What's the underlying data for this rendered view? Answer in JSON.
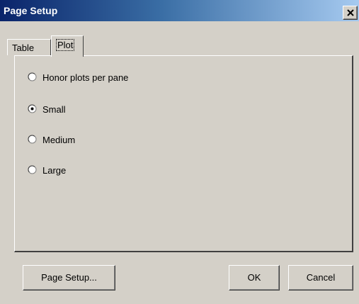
{
  "window": {
    "title": "Page Setup",
    "close_icon": "close-icon"
  },
  "tabs": [
    {
      "label": "Table",
      "selected": false
    },
    {
      "label": "Plot",
      "selected": true
    }
  ],
  "plot_options": {
    "items": [
      {
        "label": "Honor plots per pane",
        "checked": false
      },
      {
        "label": "Small",
        "checked": true
      },
      {
        "label": "Medium",
        "checked": false
      },
      {
        "label": "Large",
        "checked": false
      }
    ]
  },
  "buttons": {
    "page_setup": "Page Setup...",
    "ok": "OK",
    "cancel": "Cancel"
  }
}
